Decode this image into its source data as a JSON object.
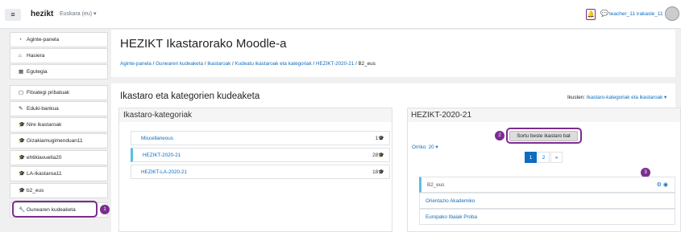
{
  "navbar": {
    "menu_icon": "hamburger-icon",
    "brand": "hezikt",
    "lang": "Euskara (eu) ▾",
    "user": "teacher_11 irakasle_11"
  },
  "sidebar": {
    "items": [
      {
        "icon": "tachometer-icon",
        "label": "Aginte-panela"
      },
      {
        "icon": "home-icon",
        "label": "Hasiera"
      },
      {
        "icon": "calendar-icon",
        "label": "Egutegia"
      },
      {
        "icon": "file-icon",
        "label": "Fitxategi pribatuak"
      },
      {
        "icon": "pencil-icon",
        "label": "Eduki-bankua"
      },
      {
        "icon": "graduation-cap-icon",
        "label": "Nire ikastaroak"
      },
      {
        "icon": "graduation-cap-icon",
        "label": "Gizakiamugimenduan11"
      },
      {
        "icon": "graduation-cap-icon",
        "label": "ehtiklavuelta20"
      },
      {
        "icon": "graduation-cap-icon",
        "label": "LA-Ikastaroa11"
      },
      {
        "icon": "graduation-cap-icon",
        "label": "b2_eus"
      },
      {
        "icon": "wrench-icon",
        "label": "Gunearen kudeaketa"
      }
    ]
  },
  "header": {
    "title": "HEZIKT Ikastarorako Moodle-a",
    "breadcrumb": [
      "Aginte-panela",
      "Gunearen kudeaketa",
      "Ikastaroak",
      "Kudeatu ikastaroak eta kategoriak",
      "HEZIKT-2020-21",
      "B2_eus"
    ]
  },
  "main": {
    "title": "Ikastaro eta kategorien kudeaketa",
    "view_label": "Ikusten:",
    "view_value": "Ikastaro-kategoriak eta ikastaroak ▾"
  },
  "categories": {
    "header": "Ikastaro-kategoriak",
    "rows": [
      {
        "name": "Miscellaneous",
        "count": "1"
      },
      {
        "name": "HEZIKT-2020-21",
        "count": "28"
      },
      {
        "name": "HEZIKT-LA-2020-21",
        "count": "18"
      }
    ]
  },
  "courses": {
    "header": "HEZIKT-2020-21",
    "new_course": "Sortu beste ikastaro bat",
    "per_page": "Orriko: 20 ▾",
    "pages": [
      "1",
      "2",
      "»"
    ],
    "rows": [
      "B2_eus",
      "Orientazio Akademiko",
      "Europako Ibaiak Proba"
    ]
  },
  "badges": [
    "1",
    "2",
    "3"
  ],
  "colors": {
    "accent": "#0f6cbf",
    "highlight": "#7b2d8e",
    "active_border": "#5bc0de"
  }
}
